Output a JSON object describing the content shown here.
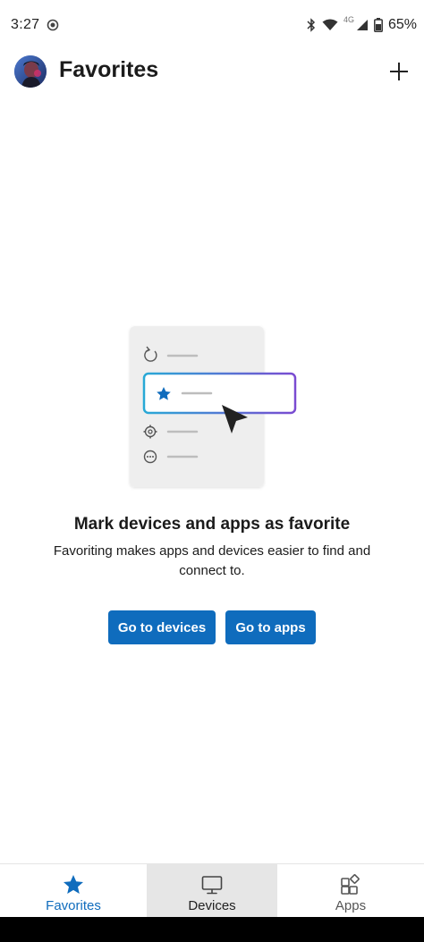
{
  "status_bar": {
    "time": "3:27",
    "network": "4G",
    "battery": "65%"
  },
  "header": {
    "title": "Favorites"
  },
  "empty_state": {
    "title": "Mark devices and apps as favorite",
    "description": "Favoriting makes apps and devices easier to find and connect to.",
    "primary_button": "Go to devices",
    "secondary_button": "Go to apps"
  },
  "bottom_nav": {
    "items": [
      {
        "label": "Favorites",
        "icon": "star-icon",
        "selected": true
      },
      {
        "label": "Devices",
        "icon": "monitor-icon",
        "selected": false
      },
      {
        "label": "Apps",
        "icon": "apps-grid-icon",
        "selected": false
      }
    ]
  },
  "colors": {
    "accent": "#0f6cbd",
    "highlight_gradient_start": "#28a9d6",
    "highlight_gradient_end": "#7a4bd1",
    "selected_tab_bg": "#e6e6e6"
  }
}
